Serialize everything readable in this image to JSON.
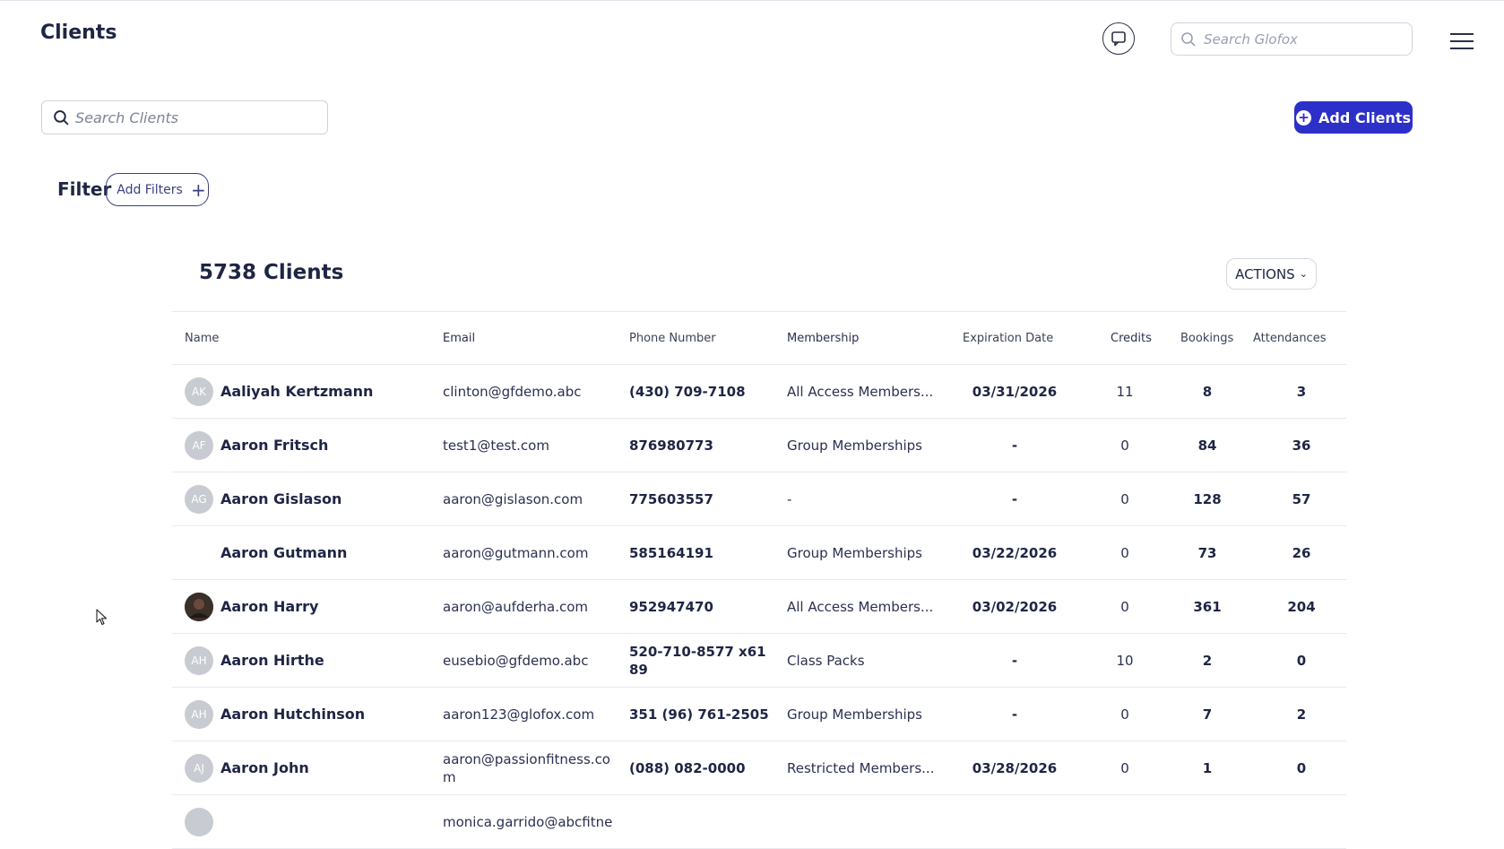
{
  "header": {
    "title": "Clients",
    "global_search_placeholder": "Search Glofox"
  },
  "toolbar": {
    "client_search_placeholder": "Search Clients",
    "add_clients_label": "Add Clients",
    "filter_label": "Filter",
    "add_filters_label": "Add Filters"
  },
  "summary": {
    "count_label": "5738 Clients",
    "actions_label": "ACTIONS"
  },
  "table": {
    "columns": [
      "Name",
      "Email",
      "Phone Number",
      "Membership",
      "Expiration Date",
      "Credits",
      "Bookings",
      "Attendances"
    ],
    "rows": [
      {
        "initials": "AK",
        "avatar": "initials",
        "name": "Aaliyah Kertzmann",
        "email": "clinton@gfdemo.abc",
        "phone": "(430) 709-7108",
        "membership": "All Access Members...",
        "expiration": "03/31/2026",
        "credits": "11",
        "bookings": "8",
        "attendances": "3"
      },
      {
        "initials": "AF",
        "avatar": "initials",
        "name": "Aaron Fritsch",
        "email": "test1@test.com",
        "phone": "876980773",
        "membership": "Group Memberships",
        "expiration": "-",
        "credits": "0",
        "bookings": "84",
        "attendances": "36"
      },
      {
        "initials": "AG",
        "avatar": "initials",
        "name": "Aaron Gislason",
        "email": "aaron@gislason.com",
        "phone": "775603557",
        "membership": "-",
        "expiration": "-",
        "credits": "0",
        "bookings": "128",
        "attendances": "57"
      },
      {
        "initials": "",
        "avatar": "blank",
        "name": "Aaron Gutmann",
        "email": "aaron@gutmann.com",
        "phone": "585164191",
        "membership": "Group Memberships",
        "expiration": "03/22/2026",
        "credits": "0",
        "bookings": "73",
        "attendances": "26"
      },
      {
        "initials": "",
        "avatar": "photo",
        "name": "Aaron Harry",
        "email": "aaron@aufderha.com",
        "phone": "952947470",
        "membership": "All Access Members...",
        "expiration": "03/02/2026",
        "credits": "0",
        "bookings": "361",
        "attendances": "204"
      },
      {
        "initials": "AH",
        "avatar": "initials",
        "name": "Aaron Hirthe",
        "email": "eusebio@gfdemo.abc",
        "phone": "520-710-8577 x6189",
        "membership": "Class Packs",
        "expiration": "-",
        "credits": "10",
        "bookings": "2",
        "attendances": "0"
      },
      {
        "initials": "AH",
        "avatar": "initials",
        "name": "Aaron Hutchinson",
        "email": "aaron123@glofox.com",
        "phone": "351 (96) 761-2505",
        "membership": "Group Memberships",
        "expiration": "-",
        "credits": "0",
        "bookings": "7",
        "attendances": "2"
      },
      {
        "initials": "AJ",
        "avatar": "initials",
        "name": "Aaron John",
        "email": "aaron@passionfitness.com",
        "phone": "(088) 082-0000",
        "membership": "Restricted Members...",
        "expiration": "03/28/2026",
        "credits": "0",
        "bookings": "1",
        "attendances": "0"
      },
      {
        "initials": "",
        "avatar": "initials",
        "name": "",
        "email": "monica.garrido@abcfitne",
        "phone": "",
        "membership": "",
        "expiration": "",
        "credits": "",
        "bookings": "",
        "attendances": ""
      }
    ]
  },
  "colors": {
    "primary": "#2d30c8",
    "text": "#1f2544",
    "avatar_bg": "#c9cbd2",
    "border": "#e8e9ee"
  }
}
